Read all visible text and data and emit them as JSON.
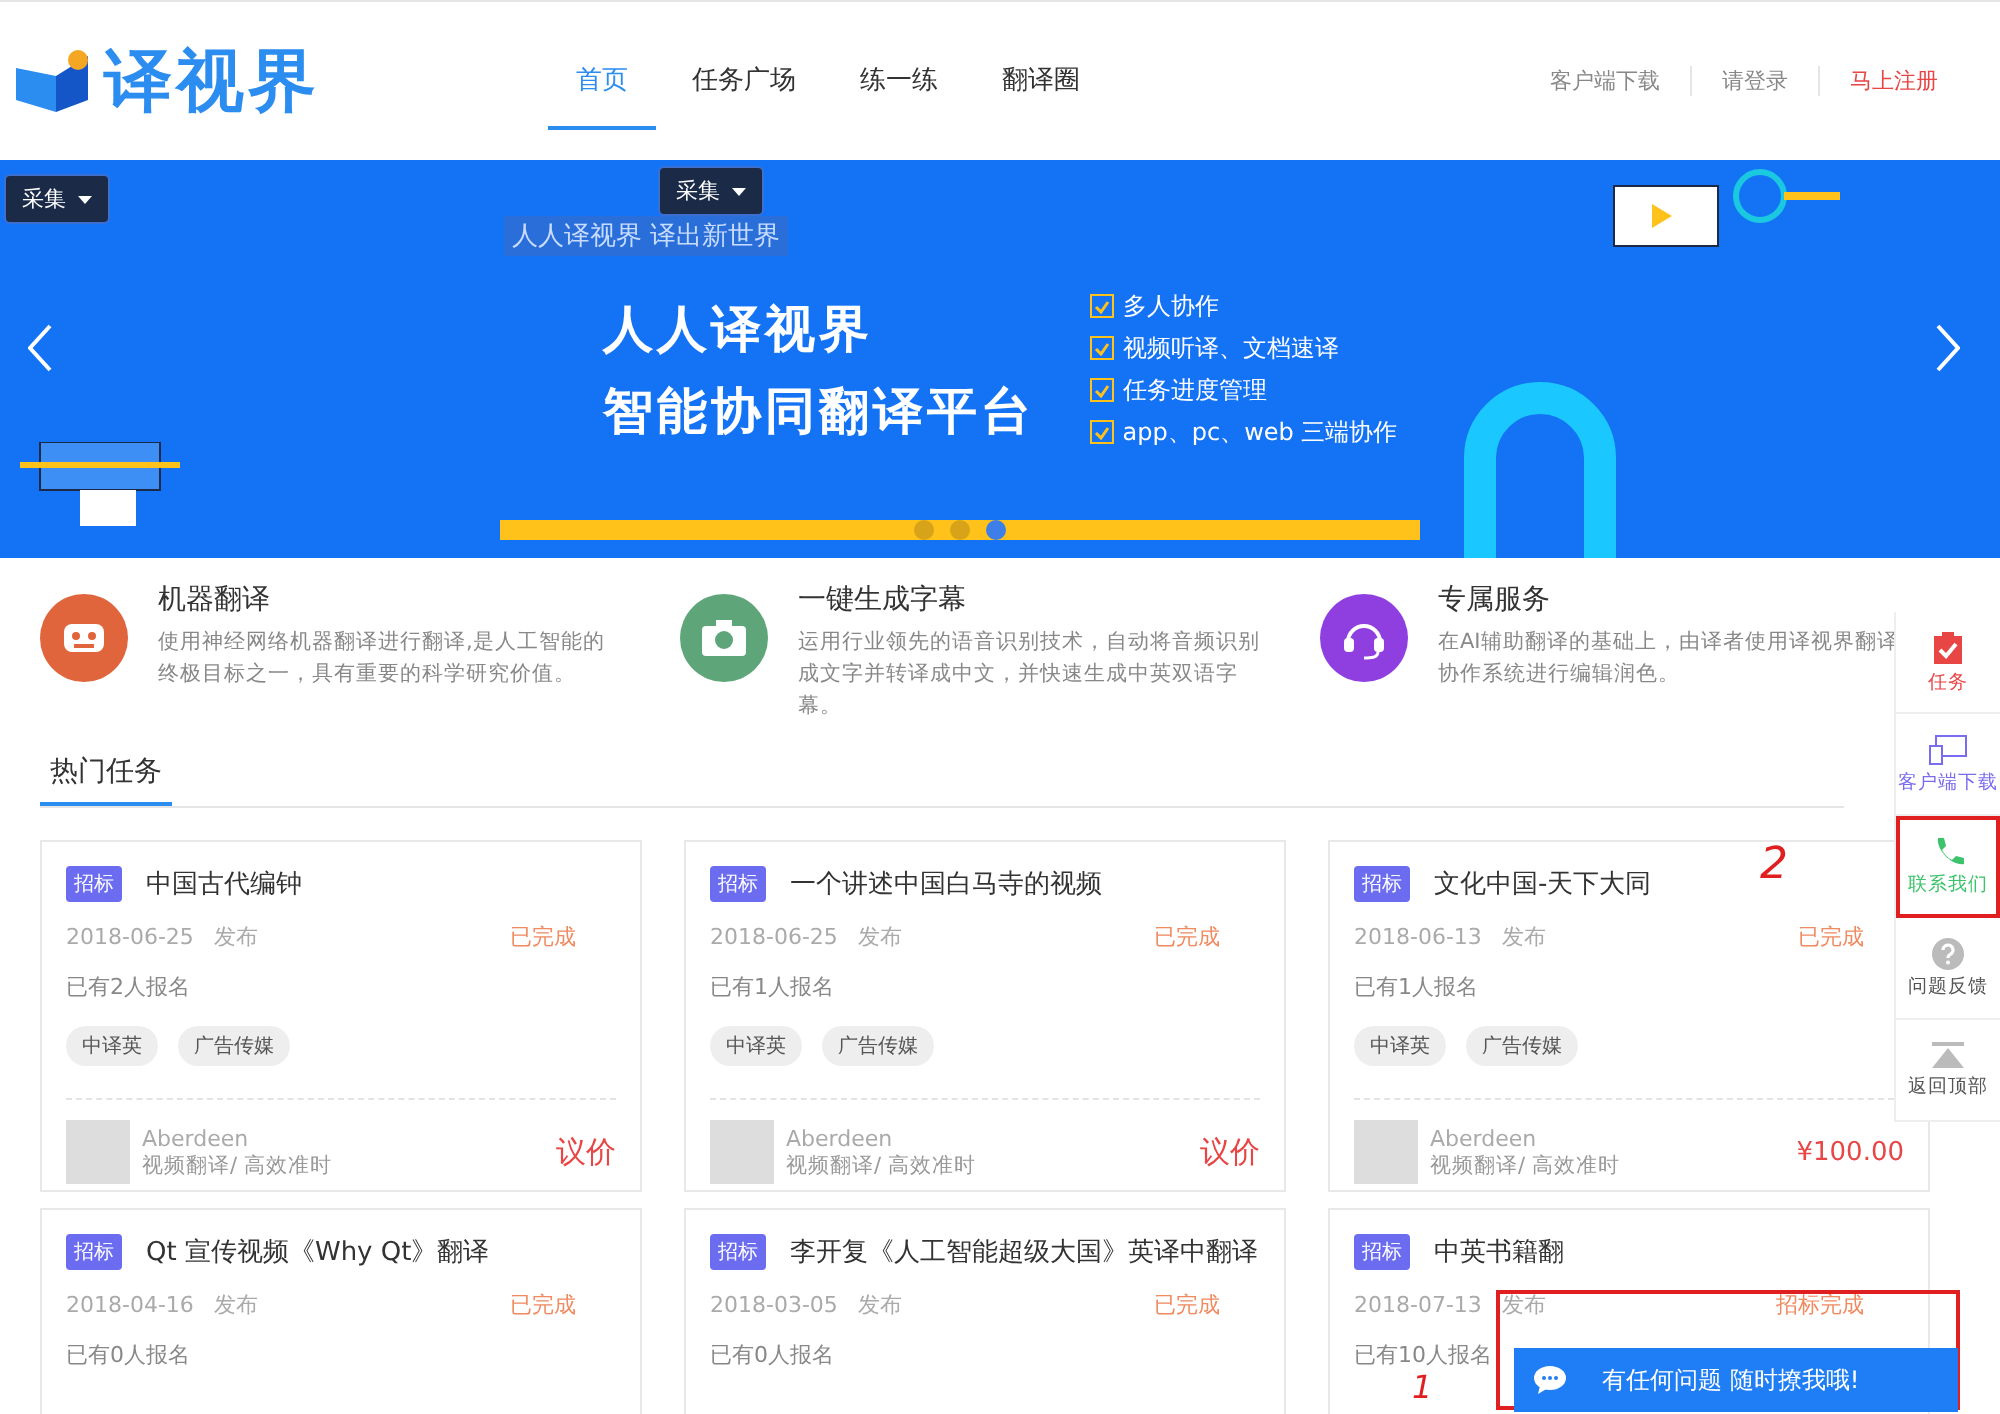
{
  "header": {
    "logo": "译视界",
    "nav": [
      {
        "label": "首页",
        "selected": true
      },
      {
        "label": "任务广场",
        "selected": false
      },
      {
        "label": "练一练",
        "selected": false
      },
      {
        "label": "翻译圈",
        "selected": false
      }
    ],
    "links": [
      {
        "label": "客户端下载",
        "kind": "plain"
      },
      {
        "label": "请登录",
        "kind": "plain"
      },
      {
        "label": "马上注册",
        "kind": "accent"
      }
    ]
  },
  "banner": {
    "dropdowns": [
      "采集",
      "采集"
    ],
    "slogan": "人人译视界  译出新世界",
    "headline": [
      "人人译视界",
      "智能协同翻译平台"
    ],
    "features": [
      {
        "label": "多人协作",
        "checked": true
      },
      {
        "label": "视频听译、文档速译",
        "checked": true
      },
      {
        "label": "任务进度管理",
        "checked": true
      },
      {
        "label": "app、pc、web 三端协作",
        "checked": true
      }
    ],
    "dots": [
      {
        "selected": false
      },
      {
        "selected": false
      },
      {
        "selected": true
      }
    ]
  },
  "services": [
    {
      "title": "机器翻译",
      "text": "使用神经网络机器翻译进行翻译,是人工智能的终极目标之一，具有重要的科学研究价值。",
      "color": "#e0643c",
      "kind": "robot"
    },
    {
      "title": "一键生成字幕",
      "text": "运用行业领先的语音识别技术，自动将音频识别成文字并转译成中文，并快速生成中英双语字幕。",
      "color": "#5ea67a",
      "kind": "camera"
    },
    {
      "title": "专属服务",
      "text": "在AI辅助翻译的基础上，由译者使用译视界翻译协作系统进行编辑润色。",
      "color": "#8f3fe0",
      "kind": "headset"
    }
  ],
  "hot_title": "热门任务",
  "tasks": [
    {
      "badge": "招标",
      "title": "中国古代编钟",
      "date": "2018-06-25",
      "posted": "发布",
      "status": "已完成",
      "signups": "已有2人报名",
      "tags": [
        "中译英",
        "广告传媒"
      ],
      "user": "Aberdeen",
      "desc": "视频翻译/ 高效准时",
      "price": "议价"
    },
    {
      "badge": "招标",
      "title": "一个讲述中国白马寺的视频",
      "date": "2018-06-25",
      "posted": "发布",
      "status": "已完成",
      "signups": "已有1人报名",
      "tags": [
        "中译英",
        "广告传媒"
      ],
      "user": "Aberdeen",
      "desc": "视频翻译/ 高效准时",
      "price": "议价"
    },
    {
      "badge": "招标",
      "title": "文化中国-天下大同",
      "date": "2018-06-13",
      "posted": "发布",
      "status": "已完成",
      "signups": "已有1人报名",
      "tags": [
        "中译英",
        "广告传媒"
      ],
      "user": "Aberdeen",
      "desc": "视频翻译/ 高效准时",
      "price": "¥100.00"
    },
    {
      "badge": "招标",
      "title": "Qt 宣传视频《Why Qt》翻译",
      "date": "2018-04-16",
      "posted": "发布",
      "status": "已完成",
      "signups": "已有0人报名"
    },
    {
      "badge": "招标",
      "title": "李开复《人工智能超级大国》英译中翻译",
      "date": "2018-03-05",
      "posted": "发布",
      "status": "已完成",
      "signups": "已有0人报名"
    },
    {
      "badge": "招标",
      "title": "中英书籍翻",
      "date": "2018-07-13",
      "posted": "发布",
      "status": "招标完成",
      "signups": "已有10人报名"
    }
  ],
  "side_tools": [
    {
      "label": "任务",
      "kind": "task",
      "color": "#e84545",
      "highlighted": false
    },
    {
      "label": "客户端下载",
      "kind": "device",
      "color": "#7a6cf0",
      "highlighted": false
    },
    {
      "label": "联系我们",
      "kind": "phone",
      "color": "#3cc36b",
      "highlighted": true
    },
    {
      "label": "问题反馈",
      "kind": "help",
      "color": "#555555",
      "highlighted": false
    },
    {
      "label": "返回顶部",
      "kind": "top",
      "color": "#555555",
      "highlighted": false
    }
  ],
  "annotations": [
    {
      "mark": "2"
    },
    {
      "mark": "1"
    }
  ],
  "chat": {
    "label": "有任何问题 随时撩我哦!"
  }
}
